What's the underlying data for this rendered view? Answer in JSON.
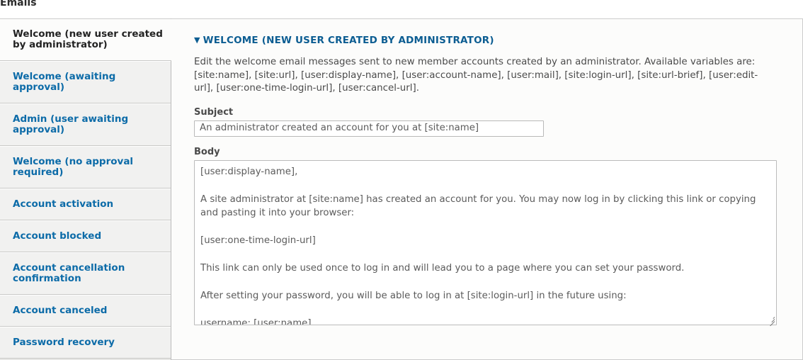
{
  "page": {
    "title": "Emails"
  },
  "tabs": [
    {
      "label": "Welcome (new user created by administrator)",
      "active": true
    },
    {
      "label": "Welcome (awaiting approval)",
      "active": false
    },
    {
      "label": "Admin (user awaiting approval)",
      "active": false
    },
    {
      "label": "Welcome (no approval required)",
      "active": false
    },
    {
      "label": "Account activation",
      "active": false
    },
    {
      "label": "Account blocked",
      "active": false
    },
    {
      "label": "Account cancellation confirmation",
      "active": false
    },
    {
      "label": "Account canceled",
      "active": false
    },
    {
      "label": "Password recovery",
      "active": false
    }
  ],
  "pane": {
    "caret": "▼",
    "heading": "WELCOME (NEW USER CREATED BY ADMINISTRATOR)",
    "description": "Edit the welcome email messages sent to new member accounts created by an administrator. Available variables are: [site:name], [site:url], [user:display-name], [user:account-name], [user:mail], [site:login-url], [site:url-brief], [user:edit-url], [user:one-time-login-url], [user:cancel-url].",
    "subject_label": "Subject",
    "subject_value": "An administrator created an account for you at [site:name]",
    "body_label": "Body",
    "body_value": "[user:display-name],\n\nA site administrator at [site:name] has created an account for you. You may now log in by clicking this link or copying and pasting it into your browser:\n\n[user:one-time-login-url]\n\nThis link can only be used once to log in and will lead you to a page where you can set your password.\n\nAfter setting your password, you will be able to log in at [site:login-url] in the future using:\n\nusername: [user:name]\npassword: Your password\n\n--  [site:name] team"
  },
  "colors": {
    "link": "#0c6ba8",
    "heading": "#0c5d92",
    "tab_active_bg": "#fcfcfb",
    "tab_bg": "#f1f1f0"
  }
}
